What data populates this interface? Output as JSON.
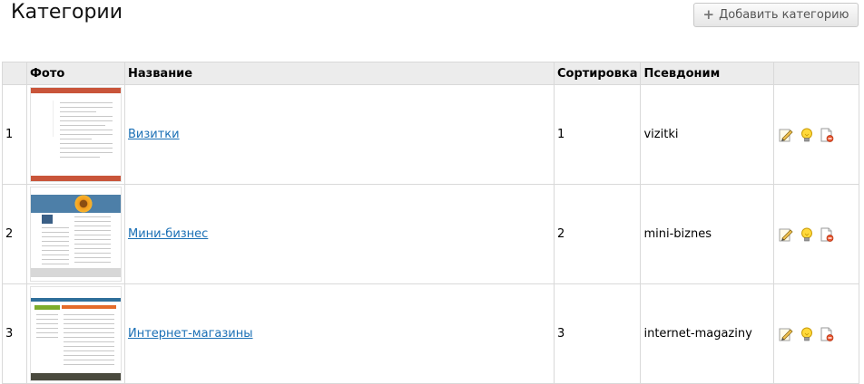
{
  "page": {
    "title": "Категории",
    "add_button": "Добавить категорию",
    "add_icon": "+"
  },
  "table": {
    "headers": {
      "num": "",
      "photo": "Фото",
      "name": "Название",
      "sort": "Сортировка",
      "alias": "Псевдоним",
      "actions": ""
    },
    "rows": [
      {
        "num": "1",
        "name": "Визитки",
        "sort": "1",
        "alias": "vizitki"
      },
      {
        "num": "2",
        "name": "Мини-бизнес",
        "sort": "2",
        "alias": "mini-biznes"
      },
      {
        "num": "3",
        "name": "Интернет-магазины",
        "sort": "3",
        "alias": "internet-magaziny"
      }
    ]
  },
  "icons": {
    "edit": "edit-icon",
    "toggle": "lightbulb-icon",
    "delete": "delete-icon"
  },
  "colors": {
    "link": "#1a6fb5",
    "header_bg": "#ececec",
    "border": "#d9d9d9"
  }
}
